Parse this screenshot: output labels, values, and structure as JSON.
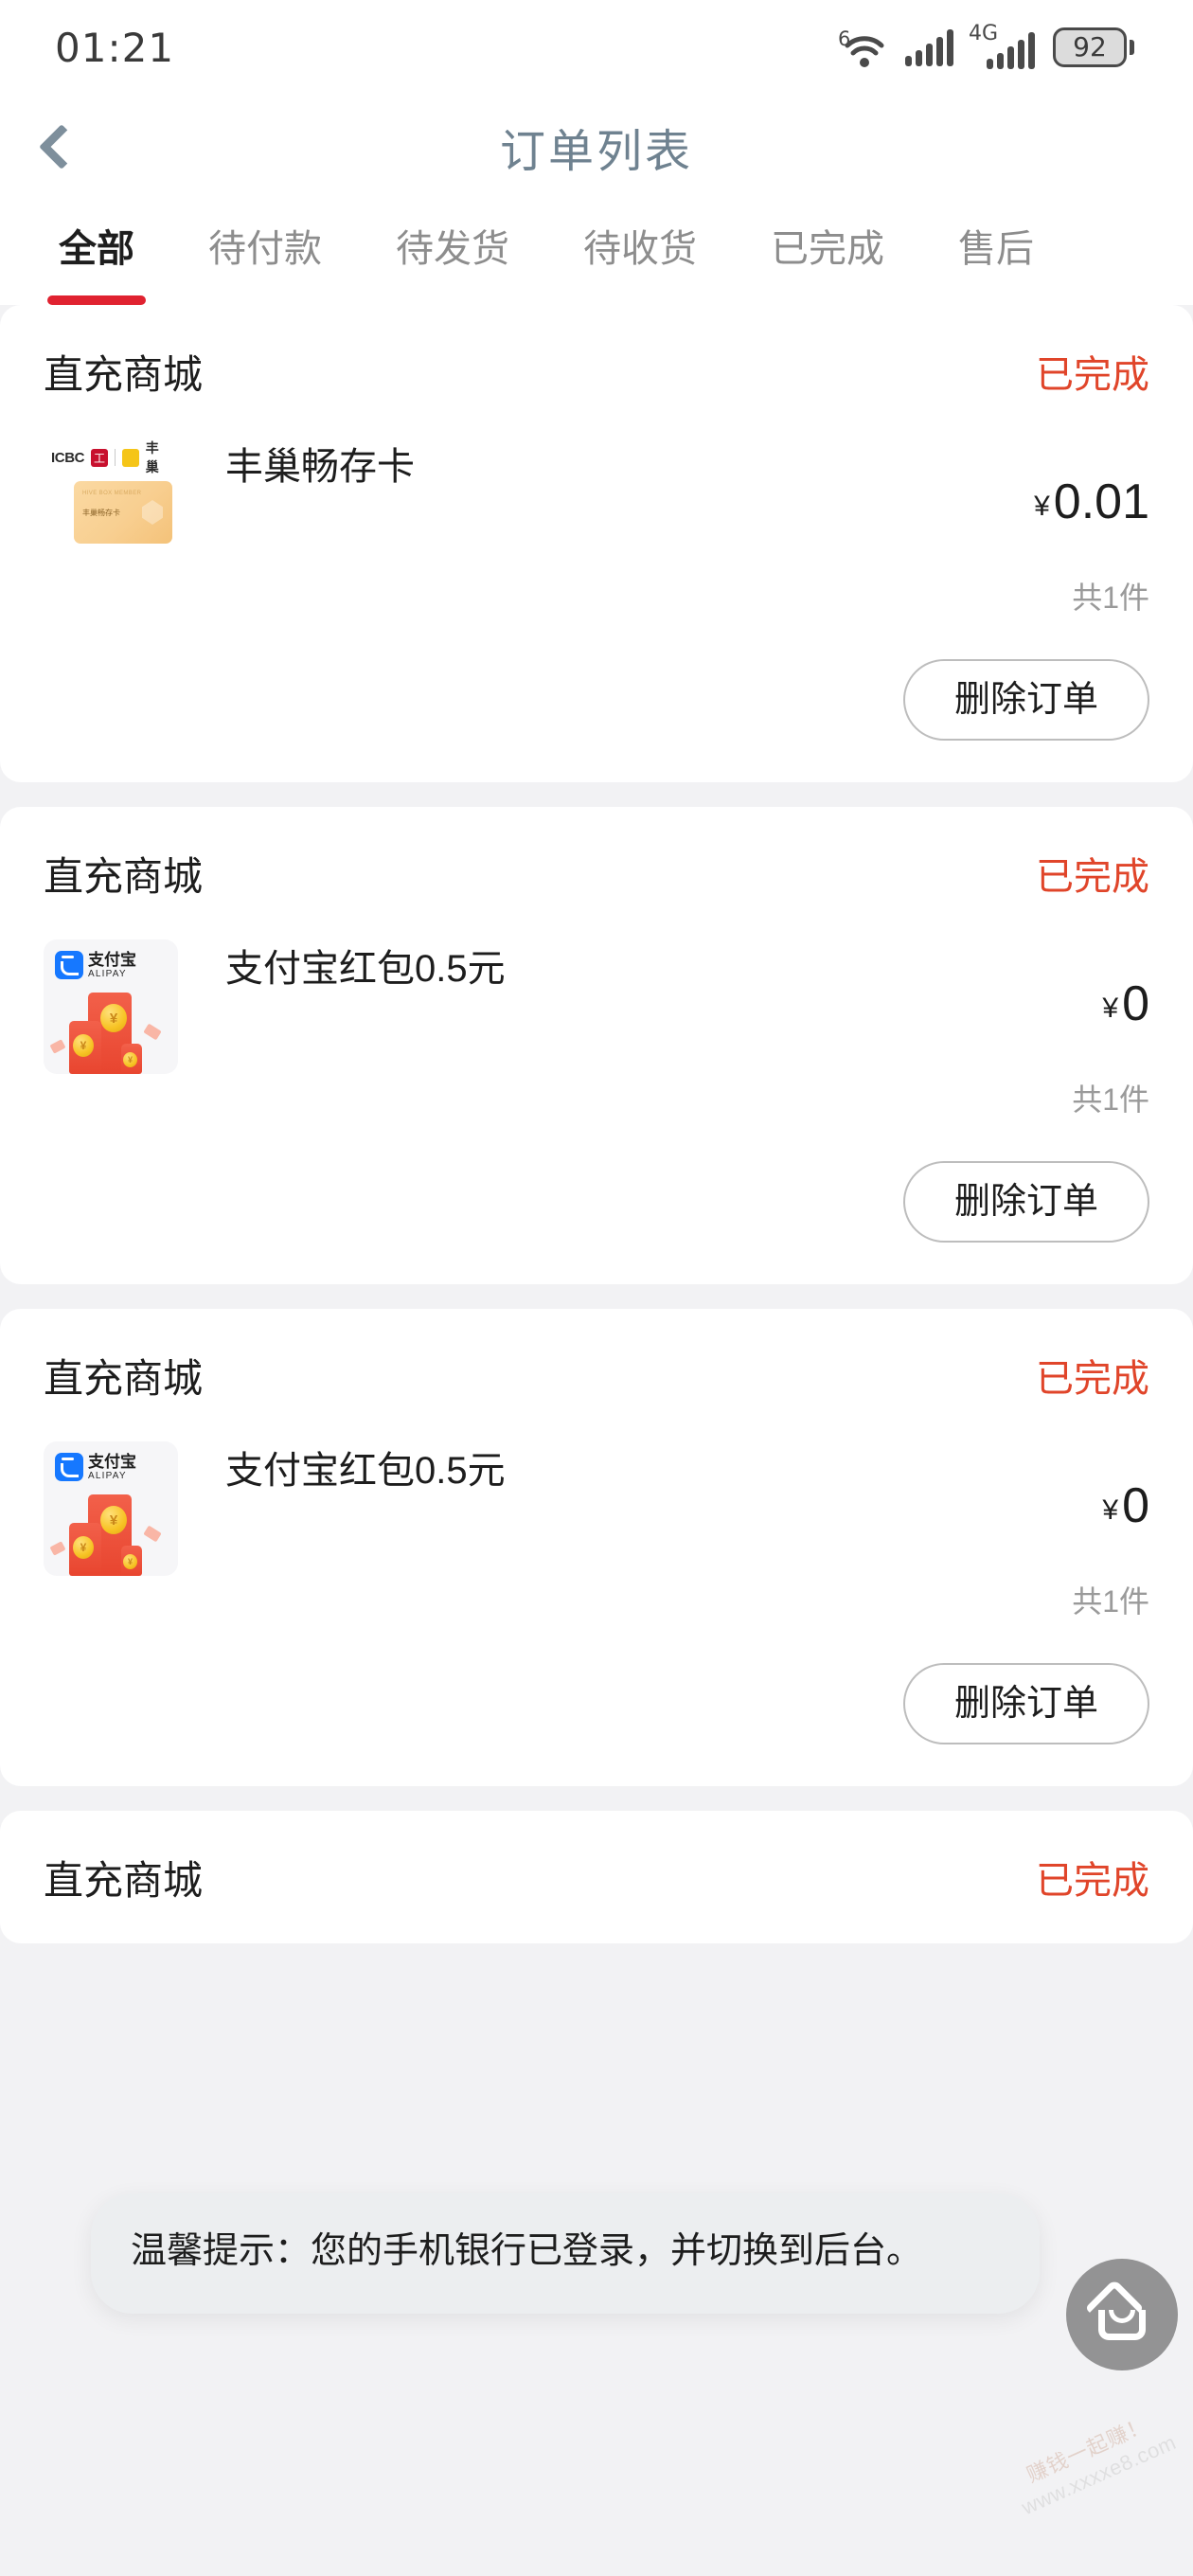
{
  "status_bar": {
    "time": "01:21",
    "wifi_generation": "6",
    "network_label": "4G",
    "battery_percent": "92"
  },
  "nav": {
    "title": "订单列表",
    "back_icon": "chevron-left-icon"
  },
  "tabs": [
    {
      "label": "全部",
      "active": true
    },
    {
      "label": "待付款",
      "active": false
    },
    {
      "label": "待发货",
      "active": false
    },
    {
      "label": "待收货",
      "active": false
    },
    {
      "label": "已完成",
      "active": false
    },
    {
      "label": "售后",
      "active": false
    }
  ],
  "orders": [
    {
      "shop": "直充商城",
      "status": "已完成",
      "item_title": "丰巢畅存卡",
      "price_symbol": "¥",
      "price": "0.01",
      "quantity": "共1件",
      "action": "删除订单",
      "thumbnail": {
        "kind": "icbc-hivebox-card",
        "brand_left": "ICBC",
        "brand_left_mark": "工",
        "brand_right": "丰巢",
        "card_line1": "HIVE BOX MEMBER",
        "card_line2": "丰巢畅存卡"
      }
    },
    {
      "shop": "直充商城",
      "status": "已完成",
      "item_title": "支付宝红包0.5元",
      "price_symbol": "¥",
      "price": "0",
      "quantity": "共1件",
      "action": "删除订单",
      "thumbnail": {
        "kind": "alipay-redpacket",
        "brand_cn": "支付宝",
        "brand_en": "ALIPAY",
        "coin_symbol": "¥"
      }
    },
    {
      "shop": "直充商城",
      "status": "已完成",
      "item_title": "支付宝红包0.5元",
      "price_symbol": "¥",
      "price": "0",
      "quantity": "共1件",
      "action": "删除订单",
      "thumbnail": {
        "kind": "alipay-redpacket",
        "brand_cn": "支付宝",
        "brand_en": "ALIPAY",
        "coin_symbol": "¥"
      }
    },
    {
      "shop": "直充商城",
      "status": "已完成",
      "item_title": "",
      "price_symbol": "",
      "price": "",
      "quantity": "",
      "action": "",
      "thumbnail": {
        "kind": "none"
      }
    }
  ],
  "toast": {
    "message": "温馨提示：您的手机银行已登录，并切换到后台。"
  },
  "fab": {
    "icon": "home-icon"
  },
  "watermark": {
    "line1": "赚钱一起赚！",
    "line2": "www.xxxxe8.com"
  },
  "colors": {
    "accent_red": "#e02230",
    "status_red": "#e0452a",
    "nav_title": "#6f8290",
    "page_bg": "#f2f2f4"
  }
}
